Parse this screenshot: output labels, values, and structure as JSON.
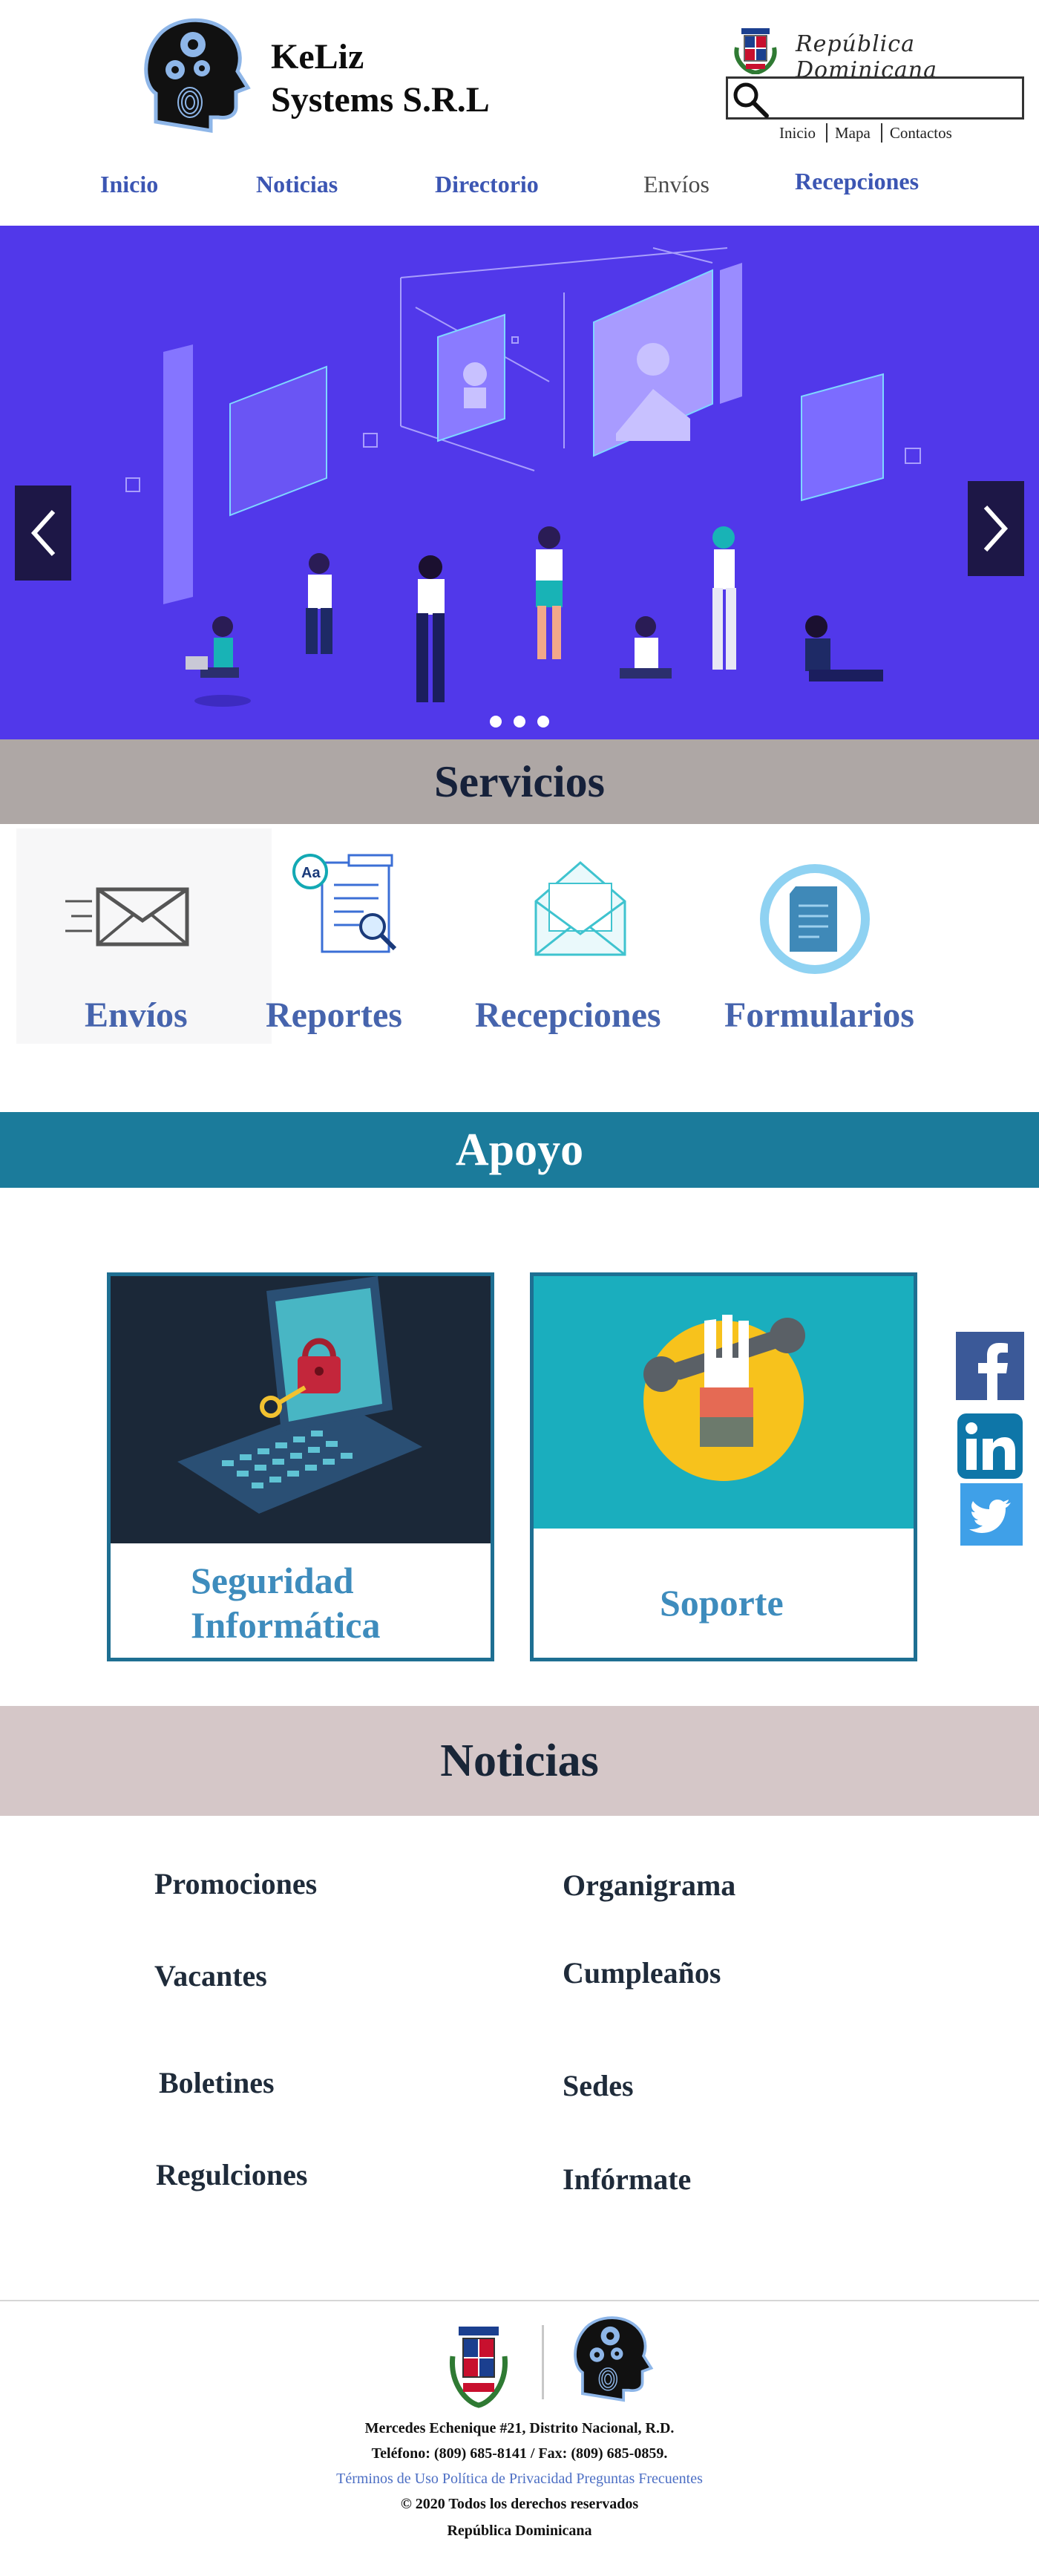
{
  "header": {
    "brand_line1": "KeLiz",
    "brand_line2": "Systems S.R.L",
    "country_script": "República Dominicana",
    "search_placeholder": "",
    "top_links": [
      "Inicio",
      "Mapa",
      "Contactos"
    ]
  },
  "nav": {
    "items": [
      "Inicio",
      "Noticias",
      "Directorio",
      "Envíos",
      "Recepciones"
    ]
  },
  "hero": {
    "slide_count": 3,
    "active_slide": 1
  },
  "servicios": {
    "title": "Servicios",
    "items": [
      {
        "label": "Envíos",
        "icon": "envelope-send-icon"
      },
      {
        "label": "Reportes",
        "icon": "document-search-icon"
      },
      {
        "label": "Recepciones",
        "icon": "open-envelope-icon"
      },
      {
        "label": "Formularios",
        "icon": "form-document-icon"
      }
    ]
  },
  "apoyo": {
    "title": "Apoyo",
    "cards": [
      {
        "label_line1": "Seguridad",
        "label_line2": "Informática",
        "icon": "laptop-lock-icon"
      },
      {
        "label": "Soporte",
        "icon": "wrench-hand-icon"
      }
    ]
  },
  "social": [
    {
      "name": "facebook-icon",
      "color": "#3b5998"
    },
    {
      "name": "linkedin-icon",
      "color": "#0e76a8"
    },
    {
      "name": "twitter-icon",
      "color": "#1da1f2"
    }
  ],
  "noticias": {
    "title": "Noticias",
    "left": [
      "Promociones",
      "Vacantes",
      "Boletines",
      "Regulciones"
    ],
    "right": [
      "Organigrama",
      "Cumpleaños",
      "Sedes",
      "Infórmate"
    ]
  },
  "footer": {
    "address": "Mercedes Echenique #21, Distrito Nacional, R.D.",
    "phone": "Teléfono: (809) 685-8141 / Fax: (809) 685-0859.",
    "links": "Términos de Uso Política de Privacidad Preguntas Frecuentes",
    "copyright": "© 2020 Todos los derechos reservados",
    "country": "República Dominicana"
  },
  "colors": {
    "hero_bg": "#5138ea",
    "servicios_band": "#aea7a5",
    "apoyo_band": "#1b7b9b",
    "noticias_band": "#d5c7c8",
    "link_blue": "#4664ad"
  }
}
